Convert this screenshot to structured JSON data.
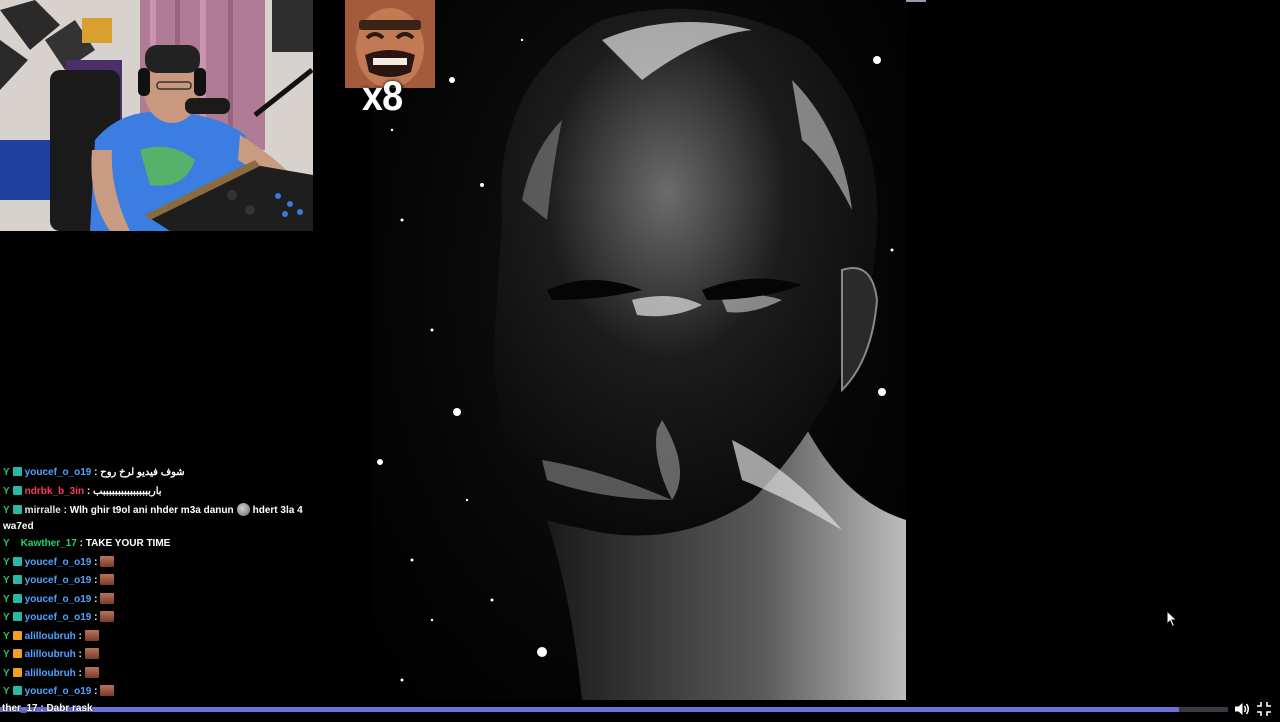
{
  "overlay": {
    "emote_counter": "x8"
  },
  "chat": {
    "messages": [
      {
        "badge": "Y",
        "sub_badge": "teal",
        "user": "youcef_o_o19",
        "user_color": "#4da3ff",
        "text": "شوف فيديو لرخ روح",
        "emotes": 0
      },
      {
        "badge": "Y",
        "sub_badge": "teal",
        "user": "ndrbk_b_3in",
        "user_color": "#ff3b5c",
        "text": "بارببببببببببببببببب",
        "emotes": 0
      },
      {
        "badge": "Y",
        "sub_badge": "teal",
        "user": "mirralle",
        "user_color": "#e5e5e5",
        "text": "Wlh ghir t9ol ani nhder m3a danun",
        "text_after": "hdert 3la 4 wa7ed",
        "emotes": 0,
        "wrap": true
      },
      {
        "badge": "Y",
        "sub_badge": "none",
        "user": "Kawther_17",
        "user_color": "#22d36e",
        "text": "TAKE YOUR TIME",
        "emotes": 0
      },
      {
        "badge": "Y",
        "sub_badge": "teal",
        "user": "youcef_o_o19",
        "user_color": "#4da3ff",
        "text": "",
        "emotes": 1
      },
      {
        "badge": "Y",
        "sub_badge": "teal",
        "user": "youcef_o_o19",
        "user_color": "#4da3ff",
        "text": "",
        "emotes": 1
      },
      {
        "badge": "Y",
        "sub_badge": "teal",
        "user": "youcef_o_o19",
        "user_color": "#4da3ff",
        "text": "",
        "emotes": 1
      },
      {
        "badge": "Y",
        "sub_badge": "teal",
        "user": "youcef_o_o19",
        "user_color": "#4da3ff",
        "text": "",
        "emotes": 1
      },
      {
        "badge": "Y",
        "sub_badge": "orange",
        "user": "alilloubruh",
        "user_color": "#4da3ff",
        "text": "",
        "emotes": 1
      },
      {
        "badge": "Y",
        "sub_badge": "orange",
        "user": "alilloubruh",
        "user_color": "#4da3ff",
        "text": "",
        "emotes": 1
      },
      {
        "badge": "Y",
        "sub_badge": "orange",
        "user": "alilloubruh",
        "user_color": "#4da3ff",
        "text": "",
        "emotes": 1
      },
      {
        "badge": "Y",
        "sub_badge": "teal",
        "user": "youcef_o_o19",
        "user_color": "#4da3ff",
        "text": "",
        "emotes": 1
      }
    ]
  },
  "player": {
    "progress": 0.96,
    "bottom_ticker": "ther_17 : Dabr rask",
    "volume_icon": "speaker-icon",
    "fullscreen_icon": "fullscreen-exit-icon"
  },
  "colors": {
    "progress_fill": "#6b71d6",
    "progress_track": "#3a3a46",
    "badge_green": "#22c55e",
    "sub_teal": "#2bb7a8",
    "sub_orange": "#f0a020"
  }
}
